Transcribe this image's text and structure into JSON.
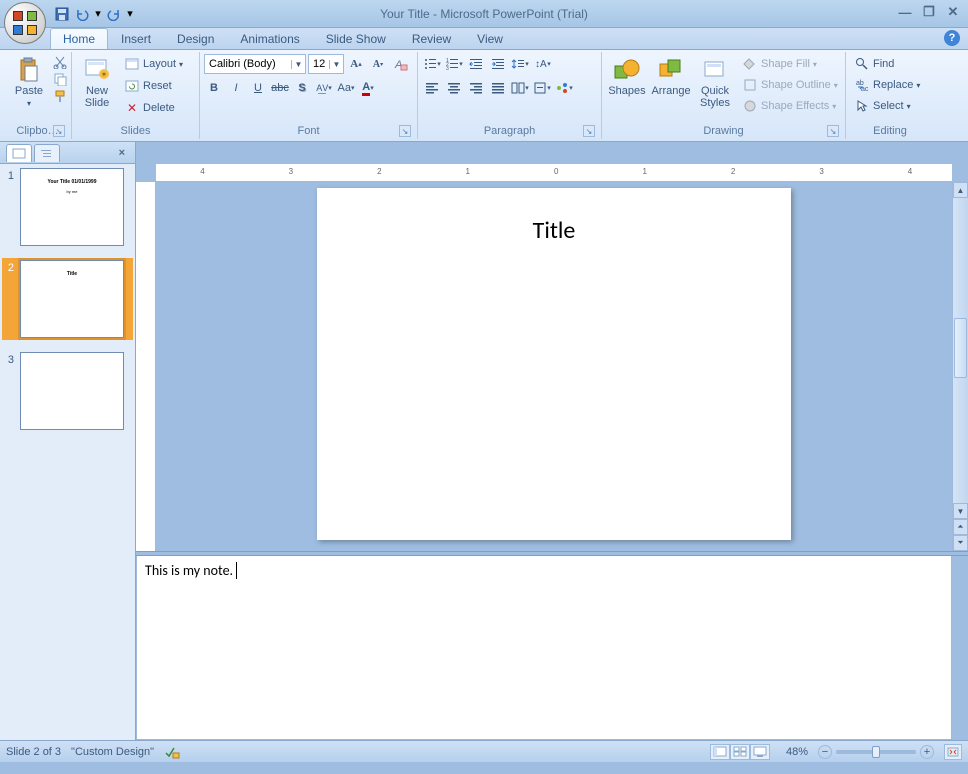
{
  "title": "Your Title - Microsoft PowerPoint (Trial)",
  "tabs": {
    "home": "Home",
    "insert": "Insert",
    "design": "Design",
    "animations": "Animations",
    "slideshow": "Slide Show",
    "review": "Review",
    "view": "View"
  },
  "ribbon": {
    "clipboard": {
      "label": "Clipbo…",
      "paste": "Paste"
    },
    "slides": {
      "label": "Slides",
      "new_slide": "New\nSlide",
      "layout": "Layout",
      "reset": "Reset",
      "delete": "Delete"
    },
    "font": {
      "label": "Font",
      "family": "Calibri (Body)",
      "size": "12"
    },
    "paragraph": {
      "label": "Paragraph"
    },
    "drawing": {
      "label": "Drawing",
      "shapes": "Shapes",
      "arrange": "Arrange",
      "quick_styles": "Quick\nStyles",
      "shape_fill": "Shape Fill",
      "shape_outline": "Shape Outline",
      "shape_effects": "Shape Effects"
    },
    "editing": {
      "label": "Editing",
      "find": "Find",
      "replace": "Replace",
      "select": "Select"
    }
  },
  "slides_panel": {
    "thumbs": [
      {
        "num": "1",
        "line1": "Your Title 01/01/1999",
        "line2": "by me"
      },
      {
        "num": "2",
        "line1": "Title",
        "line2": ""
      },
      {
        "num": "3",
        "line1": "",
        "line2": ""
      }
    ],
    "selected": 1
  },
  "editor": {
    "slide_title": "Title",
    "notes": "This is my note."
  },
  "statusbar": {
    "slide_info": "Slide 2 of 3",
    "theme": "\"Custom Design\"",
    "zoom": "48%"
  }
}
